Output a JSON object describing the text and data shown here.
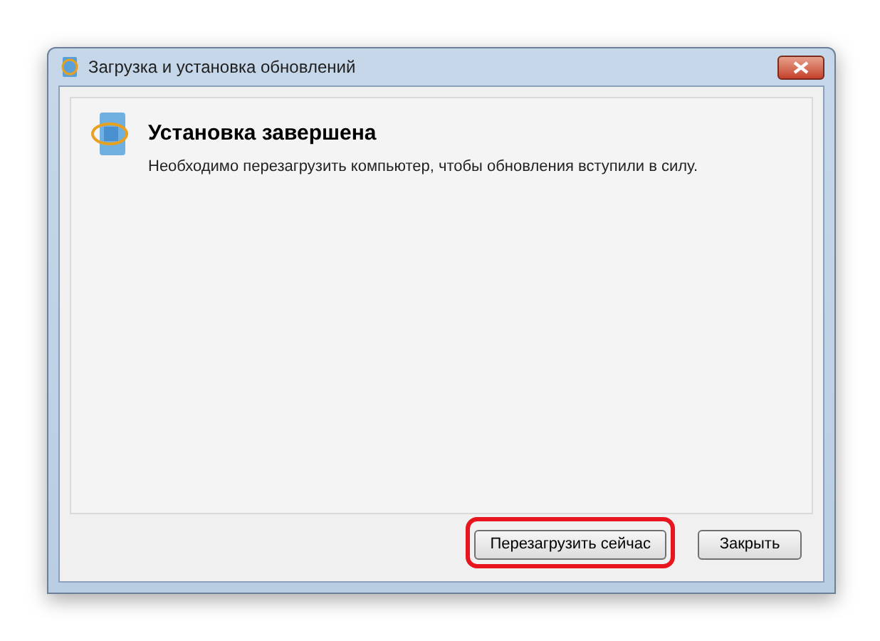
{
  "window": {
    "title": "Загрузка и установка обновлений"
  },
  "content": {
    "heading": "Установка завершена",
    "message": "Необходимо перезагрузить компьютер, чтобы обновления вступили в силу."
  },
  "buttons": [
    {
      "label": "Перезагрузить сейчас",
      "highlighted": true
    },
    {
      "label": "Закрыть",
      "highlighted": false
    }
  ]
}
